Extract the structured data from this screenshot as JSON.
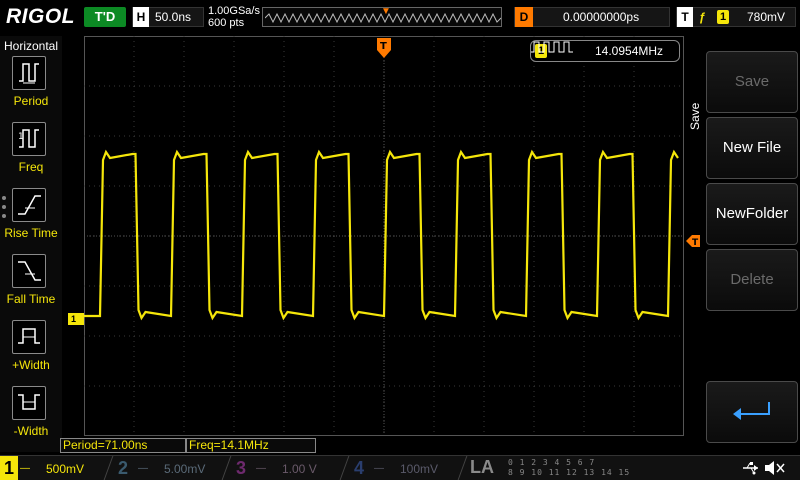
{
  "header": {
    "brand": "RIGOL",
    "trigger_state": "T'D",
    "horizontal_letter": "H",
    "timebase": "50.0ns",
    "sample_rate": "1.00GSa/s",
    "memory_depth": "600 pts",
    "delay_letter": "D",
    "delay_value": "0.00000000ps",
    "trigger_letter": "T",
    "trigger_edge": "ƒ",
    "trigger_source": "1",
    "trigger_level": "780mV"
  },
  "left_panel": {
    "title": "Horizontal",
    "items": [
      {
        "label": "Period",
        "icon": "period-icon"
      },
      {
        "label": "Freq",
        "icon": "frequency-icon"
      },
      {
        "label": "Rise Time",
        "icon": "rise-time-icon"
      },
      {
        "label": "Fall Time",
        "icon": "fall-time-icon"
      },
      {
        "label": "+Width",
        "icon": "positive-width-icon"
      },
      {
        "label": "-Width",
        "icon": "negative-width-icon"
      }
    ]
  },
  "screen": {
    "channel_marker": "1",
    "measure_badge_channel": "1",
    "measure_badge_value": "14.0954MHz"
  },
  "right_menu": {
    "title": "Save",
    "keys": [
      {
        "label": "Save",
        "state": "disabled"
      },
      {
        "label": "New File",
        "state": "enabled"
      },
      {
        "label": "NewFolder",
        "state": "enabled"
      },
      {
        "label": "Delete",
        "state": "disabled"
      }
    ],
    "return_icon": "return-arrow-icon"
  },
  "results": {
    "period": "Period=71.00ns",
    "freq": "Freq=14.1MHz"
  },
  "channels": [
    {
      "num": "1",
      "coupling": "—",
      "scale": "500mV",
      "color": "#f5e60a",
      "active": true
    },
    {
      "num": "2",
      "coupling": "—",
      "scale": "5.00mV",
      "color": "#3a5a6e",
      "active": false
    },
    {
      "num": "3",
      "coupling": "—",
      "scale": "1.00 V",
      "color": "#6e2a6e",
      "active": false
    },
    {
      "num": "4",
      "coupling": "—",
      "scale": "100mV",
      "color": "#2a3e6e",
      "active": false
    }
  ],
  "la": {
    "label": "LA",
    "row1": "0 1 2 3   4 5 6 7",
    "row2": "8 9 10 11 12 13 14 15"
  },
  "colors": {
    "ch1": "#f5e60a",
    "trigger": "#ff7a00",
    "trigger_state_bg": "#0c8a24"
  },
  "waveform": {
    "channel": "1",
    "type": "square",
    "period_ns": 71.0,
    "timebase_ns_per_div": 50.0,
    "high_fraction": 0.5
  }
}
